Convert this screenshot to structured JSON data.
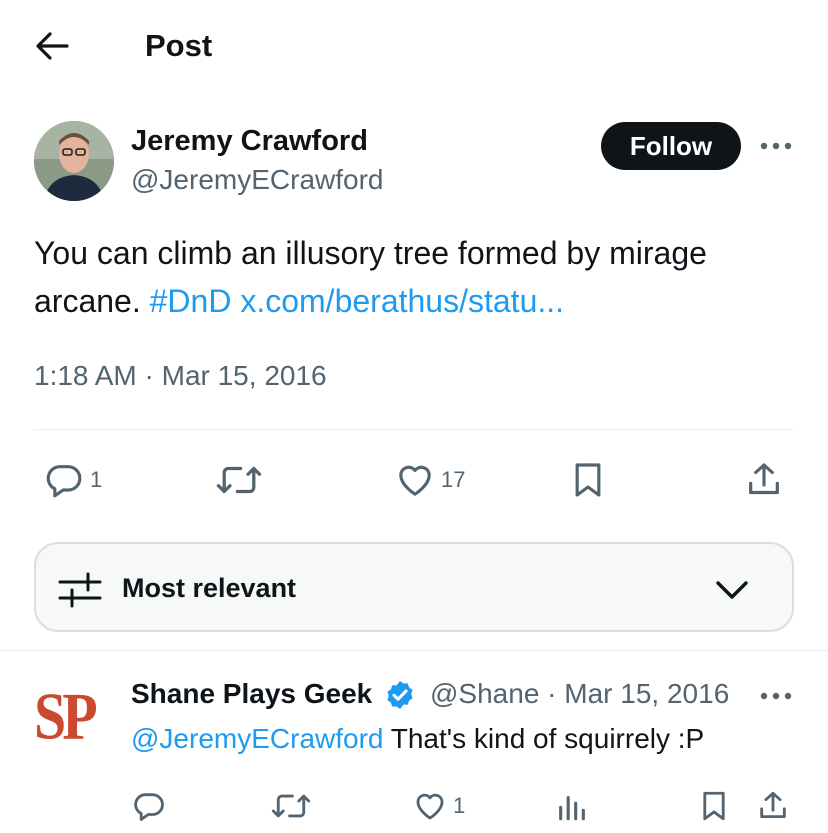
{
  "header": {
    "title": "Post"
  },
  "tweet": {
    "author_name": "Jeremy Crawford",
    "author_handle": "@JeremyECrawford",
    "follow_label": "Follow",
    "text_main": "You can climb an illusory tree formed by mirage arcane. ",
    "hashtag": "#DnD",
    "link": "x.com/berathus/statu...",
    "timestamp": "1:18 AM · Mar 15, 2016",
    "replies_count": "1",
    "likes_count": "17"
  },
  "sort": {
    "label": "Most relevant"
  },
  "reply": {
    "avatar_text": "SP",
    "name": "Shane Plays Geek",
    "meta": "@Shane · Mar 15, 2016",
    "mention": "@JeremyECrawford",
    "text": " That's kind of squirrely :P",
    "likes_count": "1"
  },
  "colors": {
    "link": "#1d9bf0",
    "text": "#0f1419",
    "muted": "#536471",
    "avatar_brand": "#c94a2e"
  },
  "icons": [
    "back-arrow-icon",
    "more-icon",
    "reply-icon",
    "retweet-icon",
    "like-icon",
    "bookmark-icon",
    "share-icon",
    "sort-filter-icon",
    "chevron-down-icon",
    "verified-icon",
    "views-icon"
  ]
}
